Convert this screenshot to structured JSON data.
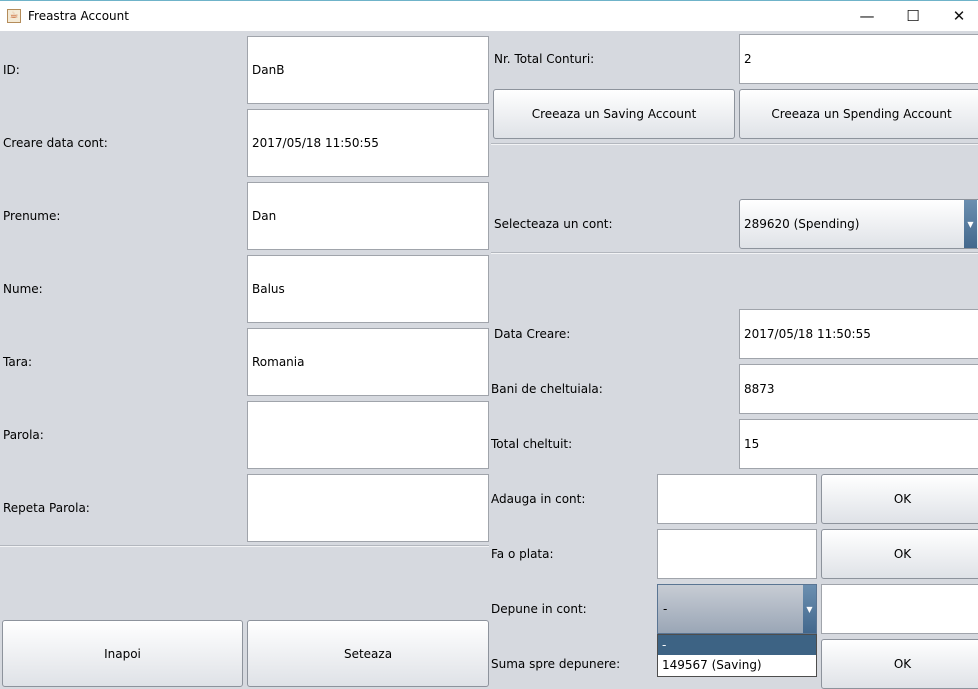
{
  "window": {
    "title": "Freastra Account",
    "app_icon": "java-cup-icon",
    "controls": {
      "minimize": "—",
      "maximize": "☐",
      "close": "✕"
    }
  },
  "left": {
    "fields": [
      {
        "label": "ID:",
        "value": "DanB"
      },
      {
        "label": "Creare data cont:",
        "value": "2017/05/18 11:50:55"
      },
      {
        "label": "Prenume:",
        "value": "Dan"
      },
      {
        "label": "Nume:",
        "value": "Balus"
      },
      {
        "label": "Tara:",
        "value": "Romania"
      },
      {
        "label": "Parola:",
        "value": ""
      },
      {
        "label": "Repeta Parola:",
        "value": ""
      }
    ],
    "back_button": "Inapoi",
    "set_button": "Seteaza"
  },
  "right": {
    "total_accounts_label": "Nr. Total Conturi:",
    "total_accounts_value": "2",
    "create_saving_button": "Creeaza un Saving Account",
    "create_spending_button": "Creeaza un Spending Account",
    "select_account_label": "Selecteaza un cont:",
    "selected_account": "289620 (Spending)",
    "created_date_label": "Data Creare:",
    "created_date_value": "2017/05/18 11:50:55",
    "spending_money_label": "Bani de cheltuiala:",
    "spending_money_value": "8873",
    "total_spent_label": "Total cheltuit:",
    "total_spent_value": "15",
    "add_label": "Adauga in cont:",
    "add_value": "",
    "add_ok": "OK",
    "pay_label": "Fa o plata:",
    "pay_value": "",
    "pay_ok": "OK",
    "deposit_label": "Depune in cont:",
    "deposit_selected": "-",
    "deposit_options": [
      "-",
      "149567 (Saving)"
    ],
    "deposit_sum_label": "Suma spre depunere:",
    "deposit_ok": "OK"
  },
  "colors": {
    "background": "#d6d9df",
    "selection": "#3d6384"
  }
}
